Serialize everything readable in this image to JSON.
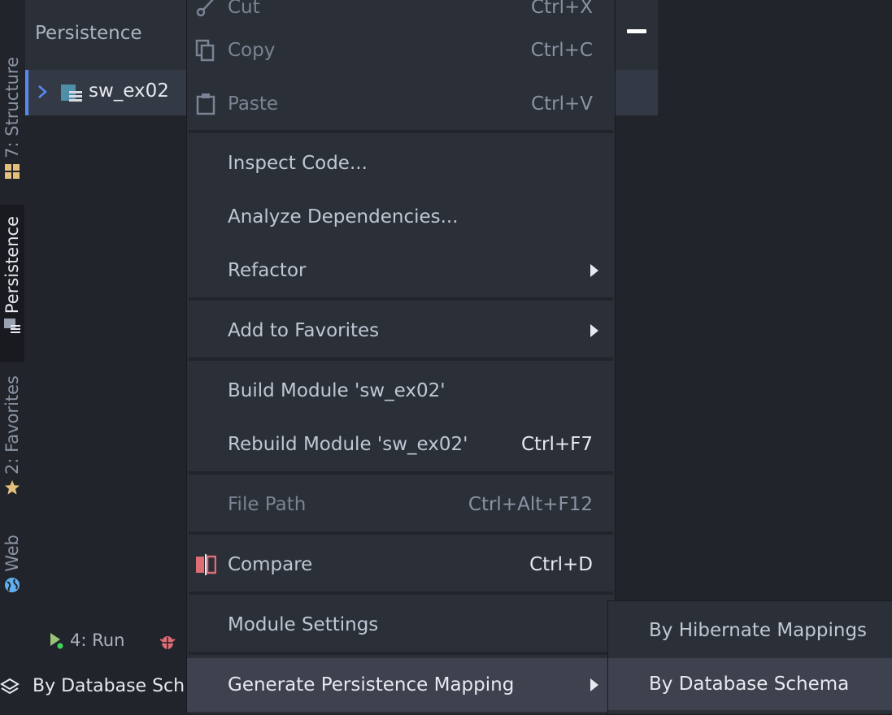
{
  "panel": {
    "title": "Persistence",
    "tree_item": "sw_ex02"
  },
  "side_tabs": [
    {
      "label": "7: Structure",
      "icon": "structure-icon"
    },
    {
      "label": "Persistence",
      "icon": "persistence-icon"
    },
    {
      "label": "2: Favorites",
      "icon": "star-icon"
    },
    {
      "label": "Web",
      "icon": "globe-icon"
    }
  ],
  "bottom": {
    "run_label": "4: Run",
    "status": "By Database Sch"
  },
  "menu": {
    "cut": {
      "label": "Cut",
      "shortcut": "Ctrl+X"
    },
    "copy": {
      "label": "Copy",
      "shortcut": "Ctrl+C"
    },
    "paste": {
      "label": "Paste",
      "shortcut": "Ctrl+V"
    },
    "inspect": {
      "label": "Inspect Code..."
    },
    "analyze": {
      "label": "Analyze Dependencies..."
    },
    "refactor": {
      "label": "Refactor"
    },
    "favorites": {
      "label": "Add to Favorites"
    },
    "build": {
      "label": "Build Module 'sw_ex02'"
    },
    "rebuild": {
      "label": "Rebuild Module 'sw_ex02'",
      "shortcut": "Ctrl+F7"
    },
    "filepath": {
      "label": "File Path",
      "shortcut": "Ctrl+Alt+F12"
    },
    "compare": {
      "label": "Compare",
      "shortcut": "Ctrl+D"
    },
    "settings": {
      "label": "Module Settings"
    },
    "generate": {
      "label": "Generate Persistence Mapping"
    }
  },
  "submenu": {
    "hibernate": "By Hibernate Mappings",
    "schema": "By Database Schema"
  },
  "colors": {
    "background": "#21252b",
    "menu": "#2b2f37",
    "selected": "#3d424e",
    "accent": "#568af2",
    "compare_icon": "#e06c75",
    "star": "#e5c07b"
  }
}
